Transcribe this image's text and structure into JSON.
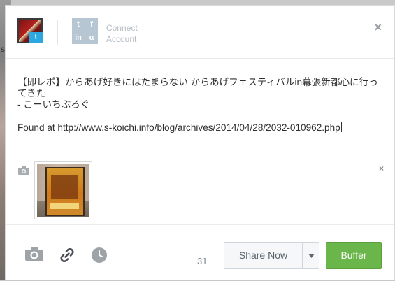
{
  "header": {
    "connect_label": "Connect\nAccount",
    "close_glyph": "×",
    "connect_icons": [
      "t",
      "f",
      "in",
      "α"
    ]
  },
  "composer": {
    "line1": "【即レポ】からあげ好きにはたまらない からあげフェスティバルin幕張新都心に行ってきた",
    "line2": " - こーいちぶろぐ",
    "found_line": "Found at http://www.s-koichi.info/blog/archives/2014/04/28/2032-010962.php"
  },
  "attachment": {
    "close_glyph": "×"
  },
  "footer": {
    "char_count": "31",
    "share_now_label": "Share Now",
    "buffer_label": "Buffer"
  },
  "background": {
    "fragment": "s"
  },
  "colors": {
    "buffer_green": "#6bb64a",
    "twitter_blue": "#2ca7e0",
    "connect_gray": "#b6c6d3"
  },
  "icons": {
    "camera": "camera-icon",
    "link": "link-icon",
    "clock": "clock-icon",
    "caret": "chevron-down-icon"
  }
}
